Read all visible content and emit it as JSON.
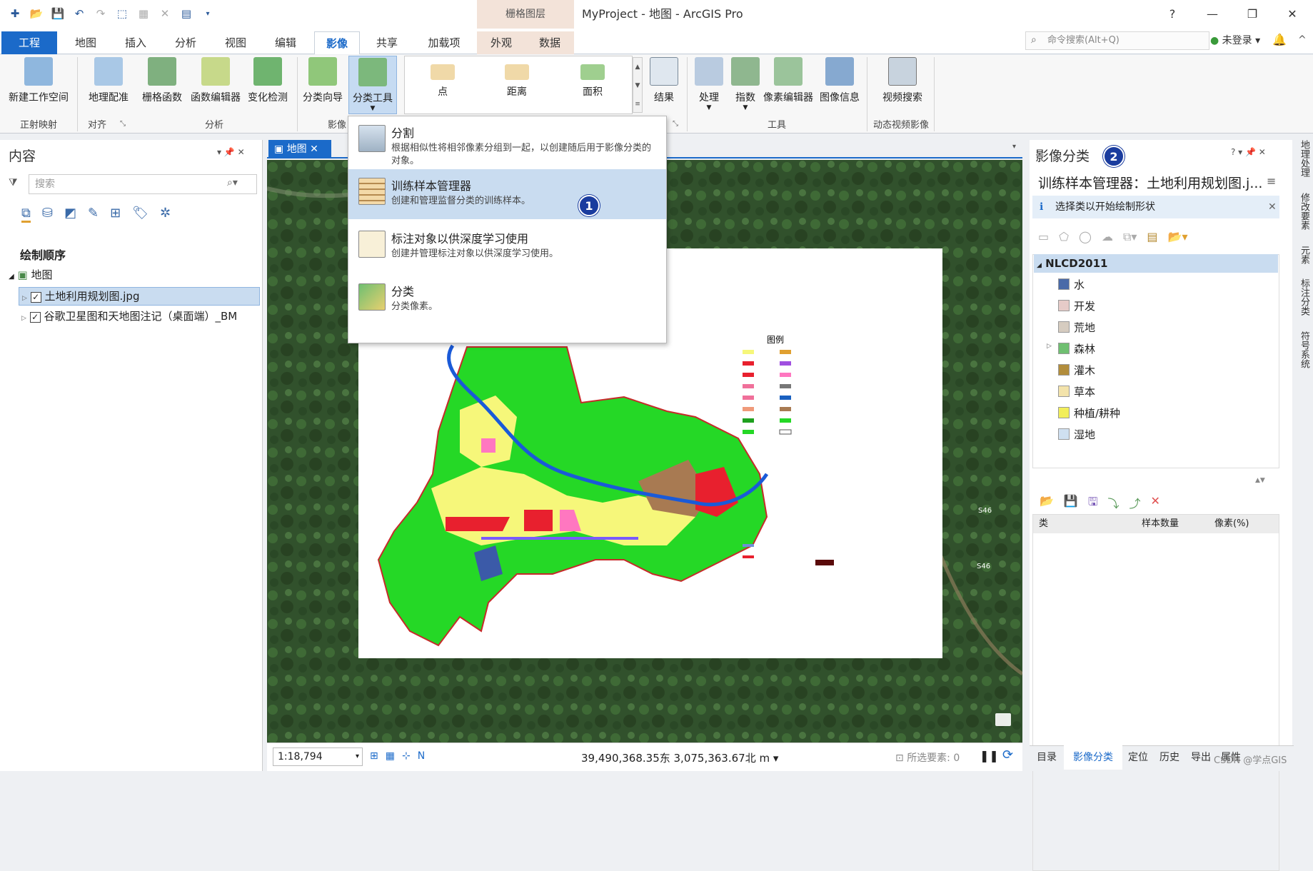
{
  "window": {
    "title": "MyProject - 地图 - ArcGIS Pro",
    "context_header": "栅格图层"
  },
  "tabs": [
    "工程",
    "地图",
    "插入",
    "分析",
    "视图",
    "编辑",
    "影像",
    "共享",
    "加载项",
    "外观",
    "数据"
  ],
  "search": {
    "placeholder": "命令搜索(Alt+Q)"
  },
  "user": {
    "login": "未登录"
  },
  "ribbon": {
    "buttons": [
      "新建工作空间",
      "地理配准",
      "栅格函数",
      "函数编辑器",
      "变化检测",
      "分类向导",
      "分类工具",
      "结果",
      "处理",
      "指数",
      "像素编辑器",
      "图像信息",
      "视频搜索"
    ],
    "gallery": [
      "点",
      "距离",
      "面积"
    ],
    "groups": [
      "正射映射",
      "对齐",
      "分析",
      "影像",
      "工具",
      "动态视频影像"
    ]
  },
  "dropdown": {
    "items": [
      {
        "title": "分割",
        "desc": "根据相似性将相邻像素分组到一起，以创建随后用于影像分类的对象。"
      },
      {
        "title": "训练样本管理器",
        "desc": "创建和管理监督分类的训练样本。"
      },
      {
        "title": "标注对象以供深度学习使用",
        "desc": "创建并管理标注对象以供深度学习使用。"
      },
      {
        "title": "分类",
        "desc": "分类像素。"
      }
    ]
  },
  "badges": [
    "1",
    "2"
  ],
  "contents": {
    "title": "内容",
    "search_placeholder": "搜索",
    "draw_order": "绘制顺序",
    "map_name": "地图",
    "layers": [
      "土地利用规划图.jpg",
      "谷歌卫星图和天地图注记（桌面端）_BM"
    ]
  },
  "map": {
    "tab": "地图",
    "scale": "1:18,794",
    "coords": "39,490,368.35东 3,075,363.67北 m",
    "selected": "所选要素: 0",
    "legend_title": "图例",
    "road_labels": [
      "S46",
      "S46"
    ]
  },
  "right_pane": {
    "title": "影像分类",
    "subtitle": "训练样本管理器：土地利用规划图.j...",
    "info": "选择类以开始绘制形状",
    "schema": "NLCD2011",
    "classes": [
      {
        "name": "水",
        "color": "#4a6aa8"
      },
      {
        "name": "开发",
        "color": "#e6cbc8"
      },
      {
        "name": "荒地",
        "color": "#d6ccc0"
      },
      {
        "name": "森林",
        "color": "#6fbf71"
      },
      {
        "name": "灌木",
        "color": "#b28d3c"
      },
      {
        "name": "草本",
        "color": "#f3e3ab"
      },
      {
        "name": "种植/耕种",
        "color": "#f2ee5a"
      },
      {
        "name": "湿地",
        "color": "#cfe0f0"
      }
    ],
    "table_headers": [
      "类",
      "样本数量",
      "像素(%)"
    ]
  },
  "right_strip": [
    "地理处理",
    "修改要素",
    "元素",
    "标注分类",
    "符号系统"
  ],
  "bottom_tabs": [
    "目录",
    "影像分类",
    "定位",
    "历史",
    "导出",
    "属性"
  ],
  "watermark": "CSDN @学点GIS"
}
